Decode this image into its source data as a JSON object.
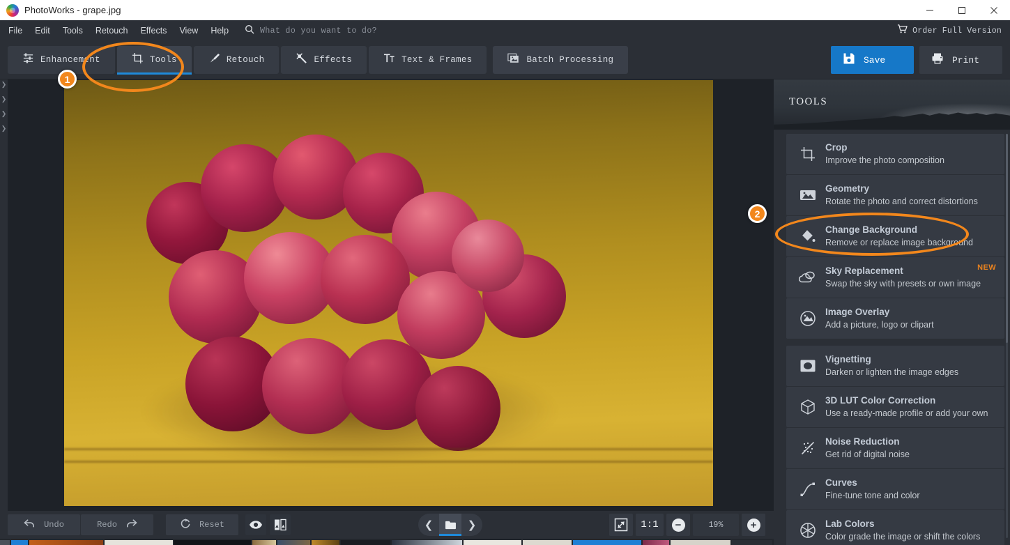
{
  "window": {
    "title": "PhotoWorks - grape.jpg",
    "logo_icon": "photoworks-logo-icon",
    "minimize_icon": "minimize-icon",
    "maximize_icon": "maximize-icon",
    "close_icon": "close-icon"
  },
  "menubar": {
    "items": [
      {
        "label": "File"
      },
      {
        "label": "Edit"
      },
      {
        "label": "Tools"
      },
      {
        "label": "Retouch"
      },
      {
        "label": "Effects"
      },
      {
        "label": "View"
      },
      {
        "label": "Help"
      }
    ],
    "search": {
      "icon": "search-icon",
      "placeholder": "What do you want to do?"
    },
    "order": {
      "icon": "shopping-cart-icon",
      "label": "Order Full Version"
    }
  },
  "tabbar": {
    "tabs": [
      {
        "label": "Enhancement",
        "icon": "sliders-icon",
        "active": false
      },
      {
        "label": "Tools",
        "icon": "crop-icon",
        "active": true
      },
      {
        "label": "Retouch",
        "icon": "brush-icon",
        "active": false
      },
      {
        "label": "Effects",
        "icon": "magic-wand-icon",
        "active": false
      },
      {
        "label": "Text & Frames",
        "icon": "text-icon",
        "active": false
      },
      {
        "label": "Batch Processing",
        "icon": "photos-stack-icon",
        "active": false
      }
    ],
    "save": {
      "label": "Save",
      "icon": "floppy-disk-icon",
      "color": "#1678c8"
    },
    "print": {
      "label": "Print",
      "icon": "printer-icon"
    }
  },
  "panel": {
    "title": "TOOLS",
    "groups": [
      {
        "items": [
          {
            "title": "Crop",
            "subtitle": "Improve the photo composition",
            "icon": "crop-icon",
            "badge": ""
          },
          {
            "title": "Geometry",
            "subtitle": "Rotate the photo and correct distortions",
            "icon": "landscape-picture-icon",
            "badge": ""
          },
          {
            "title": "Change Background",
            "subtitle": "Remove or replace image background",
            "icon": "paint-bucket-icon",
            "badge": ""
          },
          {
            "title": "Sky Replacement",
            "subtitle": "Swap the sky with presets or own image",
            "icon": "clouds-icon",
            "badge": "NEW"
          },
          {
            "title": "Image Overlay",
            "subtitle": "Add a picture, logo or clipart",
            "icon": "overlay-circle-icon",
            "badge": ""
          }
        ]
      },
      {
        "items": [
          {
            "title": "Vignetting",
            "subtitle": "Darken or lighten the image edges",
            "icon": "vignette-icon",
            "badge": ""
          },
          {
            "title": "3D LUT Color Correction",
            "subtitle": "Use a ready-made profile or add your own",
            "icon": "cube-icon",
            "badge": ""
          },
          {
            "title": "Noise Reduction",
            "subtitle": "Get rid of digital noise",
            "icon": "noise-icon",
            "badge": ""
          },
          {
            "title": "Curves",
            "subtitle": "Fine-tune tone and color",
            "icon": "curves-icon",
            "badge": ""
          },
          {
            "title": "Lab Colors",
            "subtitle": "Color grade the image or shift the colors",
            "icon": "aperture-icon",
            "badge": ""
          }
        ]
      }
    ]
  },
  "bottombar": {
    "undo": {
      "label": "Undo",
      "icon": "undo-arrow-icon"
    },
    "redo": {
      "label": "Redo",
      "icon": "redo-arrow-icon"
    },
    "reset": {
      "label": "Reset",
      "icon": "reset-circle-icon"
    },
    "preview_icon": "eye-icon",
    "compare_icon": "before-after-icon",
    "nav": {
      "prev_icon": "chevron-left-icon",
      "folder_icon": "folder-icon",
      "next_icon": "chevron-right-icon"
    },
    "zoom": {
      "fit_icon": "fit-to-screen-icon",
      "actual_label": "1:1",
      "minus_icon": "zoom-out-icon",
      "value": "19%",
      "plus_icon": "zoom-in-icon"
    }
  },
  "annotations": {
    "accent_color": "#f2871c",
    "markers": [
      {
        "number": "1",
        "target": "Tools tab"
      },
      {
        "number": "2",
        "target": "Change Background tool"
      }
    ]
  },
  "canvas": {
    "image_name": "grape.jpg",
    "left_panel_chevrons": 4
  }
}
